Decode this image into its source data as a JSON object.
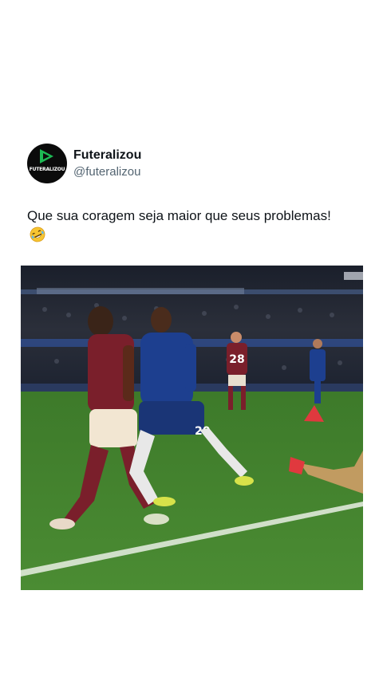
{
  "post": {
    "author": {
      "display_name": "Futeralizou",
      "handle": "@futeralizou",
      "avatar_text": "FUTERALIZOU",
      "avatar_icon": "play-logo-icon"
    },
    "text": "Que sua coragem seja maior que seus problemas!",
    "emoji": "rolling-on-floor-laughing",
    "media": {
      "type": "video-frame",
      "player_numbers": [
        "28",
        "20"
      ]
    }
  },
  "colors": {
    "brand_green": "#1db954",
    "text_primary": "#0f1419",
    "text_secondary": "#536471",
    "pitch": "#3f7a2b",
    "home_kit": "#1d3f8f",
    "away_kit": "#7a1f2b"
  }
}
